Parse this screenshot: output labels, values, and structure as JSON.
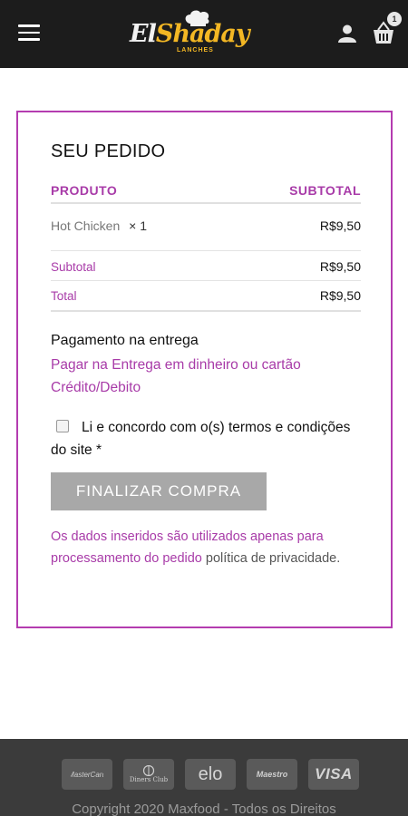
{
  "header": {
    "logo_script_1": "El",
    "logo_script_2": "Shaday",
    "logo_sub": "LANCHES",
    "cart_count": "1"
  },
  "order": {
    "title": "SEU PEDIDO",
    "col_product": "PRODUTO",
    "col_subtotal": "SUBTOTAL",
    "items": [
      {
        "name": "Hot Chicken",
        "qty": "× 1",
        "price": "R$9,50"
      }
    ],
    "subtotal_label": "Subtotal",
    "subtotal_value": "R$9,50",
    "total_label": "Total",
    "total_value": "R$9,50"
  },
  "payment": {
    "title": "Pagamento na entrega",
    "description": "Pagar na Entrega em dinheiro ou cartão Crédito/Debito"
  },
  "terms": {
    "text_before": "Li e concordo com o(s) ",
    "link": "termos e condições",
    "text_after": " do site *"
  },
  "finalize_button": "FINALIZAR COMPRA",
  "privacy": {
    "text": "Os dados inseridos são utilizados apenas para processamento do pedido ",
    "link": "política de privacidade",
    "end": "."
  },
  "footer": {
    "cards": [
      "MasterCard",
      "Diners Club",
      "elo",
      "Maestro",
      "VISA"
    ],
    "copyright": "Copyright 2020 Maxfood - Todos os Direitos"
  },
  "colors": {
    "accent": "#a83ba8",
    "border": "#b43cb0",
    "header_bg": "#1c1c1c",
    "footer_bg": "#3b3b3b",
    "button_bg": "#a8a8a8",
    "logo_gold": "#f3b724"
  }
}
